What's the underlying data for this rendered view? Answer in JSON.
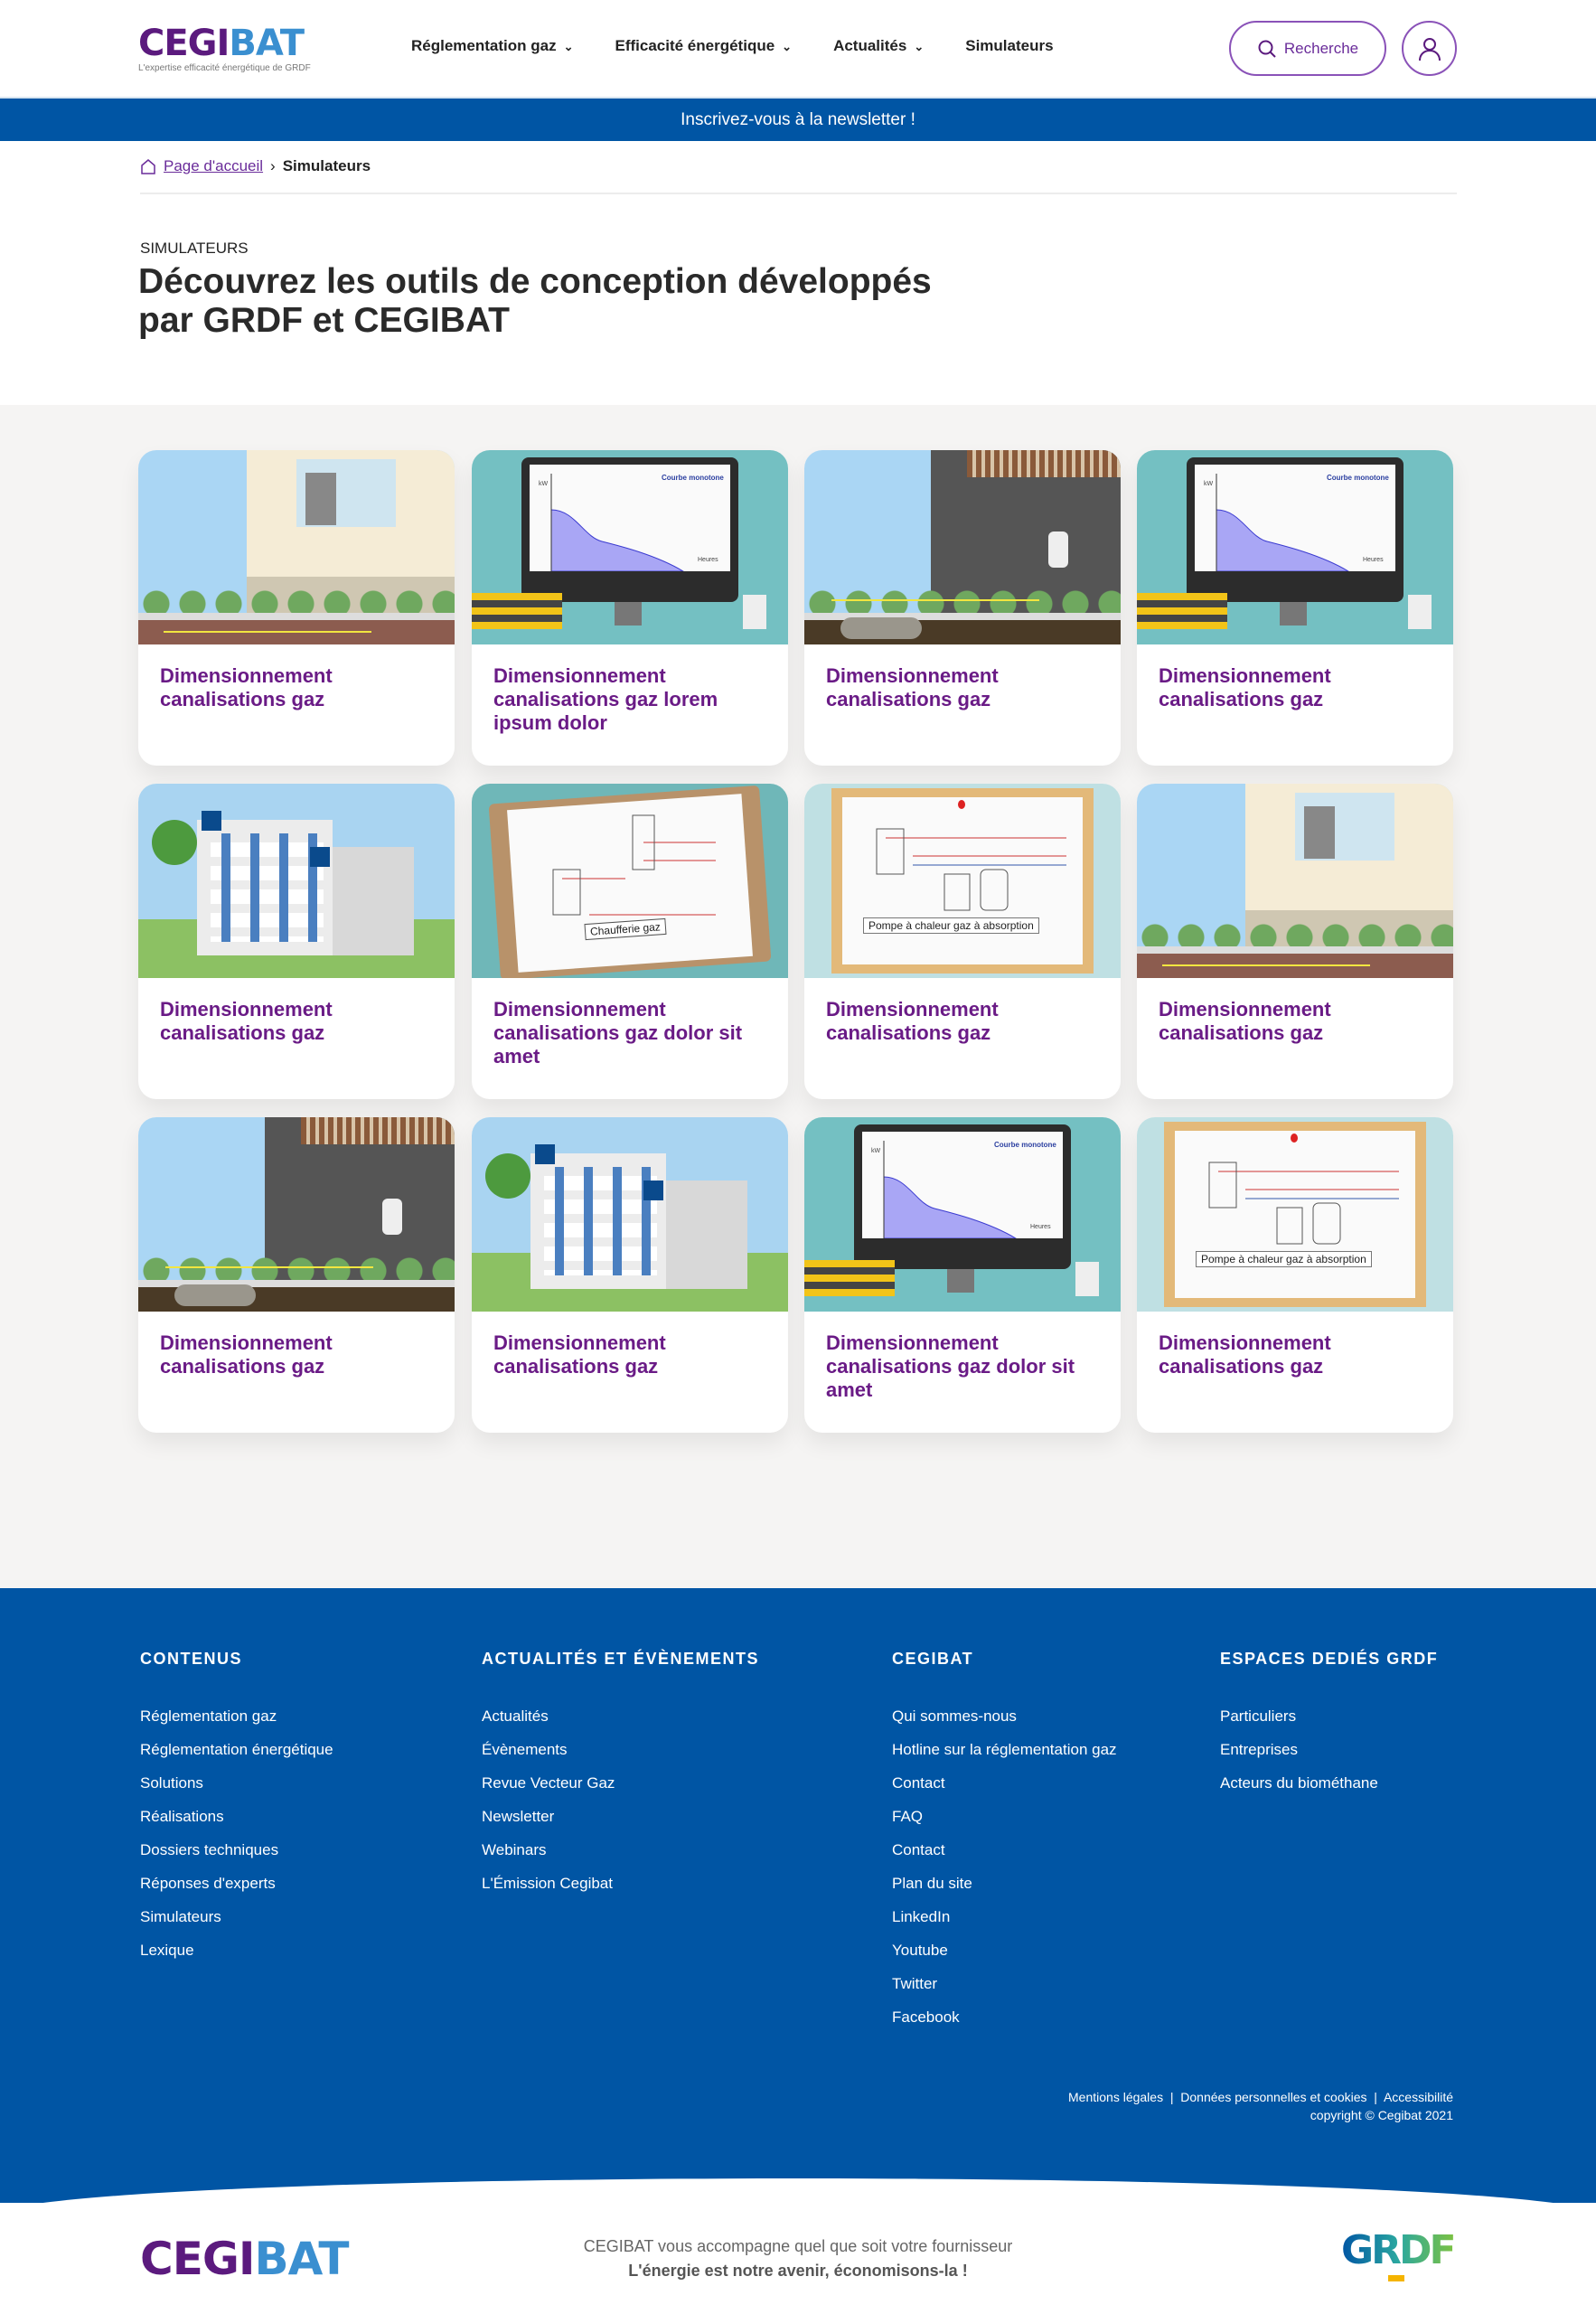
{
  "header": {
    "logo": {
      "part1": "CEGI",
      "part2": "BAT",
      "tagline": "L'expertise efficacité énergétique de GRDF"
    },
    "nav": [
      {
        "label": "Réglementation gaz",
        "dropdown": true
      },
      {
        "label": "Efficacité énergétique",
        "dropdown": true
      },
      {
        "label": "Actualités",
        "dropdown": true
      },
      {
        "label": "Simulateurs",
        "dropdown": false
      }
    ],
    "search_label": "Recherche"
  },
  "banner": "Inscrivez-vous à la newsletter !",
  "breadcrumb": {
    "home": "Page d'accueil",
    "current": "Simulateurs"
  },
  "page": {
    "eyebrow": "SIMULATEURS",
    "title": "Découvrez les outils de conception développés par GRDF et CEGIBAT"
  },
  "image_labels": {
    "chart_title": "Courbe monotone",
    "chart_y": "kW",
    "chart_x": "Heures",
    "clipboard": "Chaufferie gaz",
    "board": "Pompe à chaleur gaz à absorption"
  },
  "cards": [
    {
      "title": "Dimensionnement canalisations gaz",
      "image": "house"
    },
    {
      "title": "Dimensionnement canalisations gaz lorem ipsum dolor",
      "image": "monitor"
    },
    {
      "title": "Dimensionnement canalisations gaz",
      "image": "tank-house"
    },
    {
      "title": "Dimensionnement canalisations gaz",
      "image": "monitor"
    },
    {
      "title": "Dimensionnement canalisations gaz",
      "image": "building"
    },
    {
      "title": "Dimensionnement canalisations gaz dolor sit amet",
      "image": "clipboard"
    },
    {
      "title": "Dimensionnement canalisations gaz",
      "image": "board"
    },
    {
      "title": "Dimensionnement canalisations gaz",
      "image": "house"
    },
    {
      "title": "Dimensionnement canalisations gaz",
      "image": "tank-house"
    },
    {
      "title": "Dimensionnement canalisations gaz",
      "image": "building"
    },
    {
      "title": "Dimensionnement canalisations gaz dolor sit amet",
      "image": "monitor"
    },
    {
      "title": "Dimensionnement canalisations gaz",
      "image": "board"
    }
  ],
  "footer": {
    "columns": [
      {
        "heading": "CONTENUS",
        "links": [
          "Réglementation gaz",
          "Réglementation énergétique",
          "Solutions",
          "Réalisations",
          "Dossiers techniques",
          "Réponses d'experts",
          "Simulateurs",
          "Lexique"
        ]
      },
      {
        "heading": "ACTUALITÉS ET ÉVÈNEMENTS",
        "links": [
          "Actualités",
          "Évènements",
          "Revue Vecteur Gaz",
          "Newsletter",
          "Webinars",
          "L'Émission Cegibat"
        ]
      },
      {
        "heading": "CEGIBAT",
        "links": [
          "Qui sommes-nous",
          "Hotline sur la réglementation gaz",
          "Contact",
          "FAQ",
          "Contact",
          "Plan du site",
          "LinkedIn",
          "Youtube",
          "Twitter",
          "Facebook"
        ]
      },
      {
        "heading": "ESPACES DEDIÉS GRDF",
        "links": [
          "Particuliers",
          "Entreprises",
          "Acteurs du biométhane"
        ]
      }
    ],
    "legal": [
      "Mentions légales",
      "Données personnelles et cookies",
      "Accessibilité"
    ],
    "copyright": "copyright © Cegibat 2021"
  },
  "bottom": {
    "tagline": "CEGIBAT vous accompagne quel que soit votre fournisseur",
    "slogan": "L'énergie est notre avenir, économisons-la !",
    "partner_logo": "GRDF"
  },
  "colors": {
    "brand_purple": "#6a1b86",
    "brand_blue": "#0055a4",
    "light_blue": "#3a8fd0",
    "background_gray": "#f5f4f3"
  }
}
